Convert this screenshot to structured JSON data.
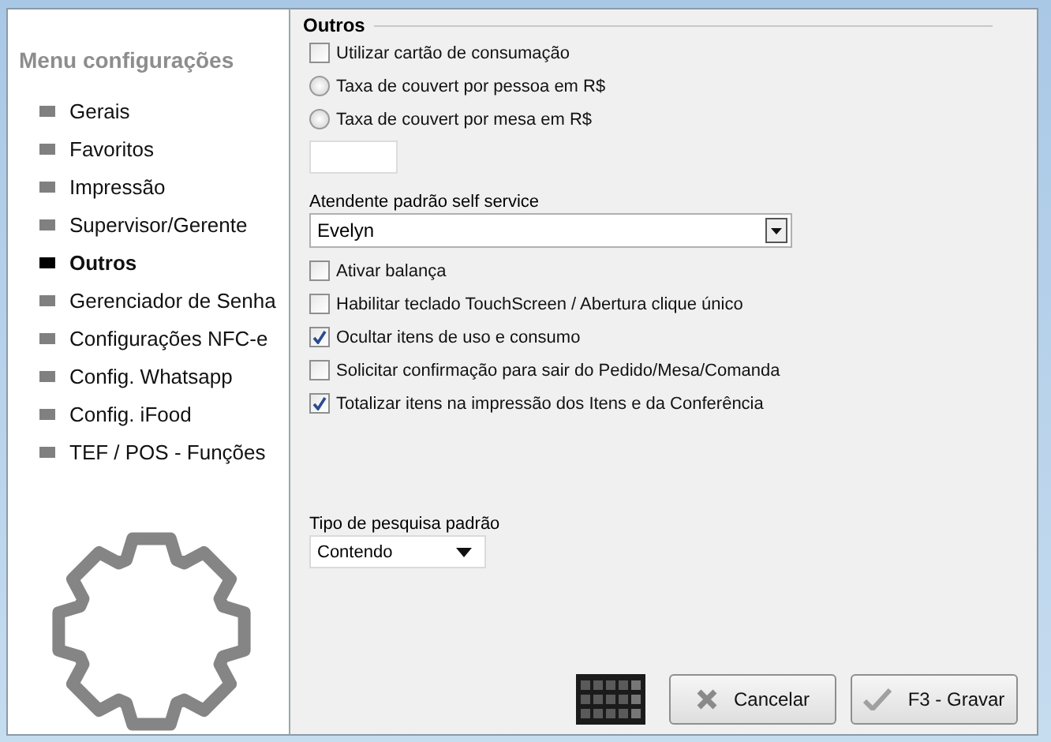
{
  "sidebar": {
    "title": "Menu configurações",
    "items": [
      {
        "label": "Gerais",
        "selected": false
      },
      {
        "label": "Favoritos",
        "selected": false
      },
      {
        "label": "Impressão",
        "selected": false
      },
      {
        "label": "Supervisor/Gerente",
        "selected": false
      },
      {
        "label": "Outros",
        "selected": true
      },
      {
        "label": "Gerenciador de Senha",
        "selected": false
      },
      {
        "label": "Configurações NFC-e",
        "selected": false
      },
      {
        "label": "Config. Whatsapp",
        "selected": false
      },
      {
        "label": "Config. iFood",
        "selected": false
      },
      {
        "label": "TEF / POS - Funções",
        "selected": false
      }
    ]
  },
  "section": {
    "title": "Outros",
    "controls": [
      {
        "kind": "checkbox",
        "label": "Utilizar cartão de consumação",
        "checked": false
      },
      {
        "kind": "radio",
        "label": "Taxa de couvert por pessoa em R$",
        "selected": false
      },
      {
        "kind": "radio",
        "label": "Taxa de couvert por mesa em R$",
        "selected": false
      },
      {
        "kind": "input"
      },
      {
        "kind": "select",
        "label": "Atendente padrão self service",
        "value": "Evelyn"
      },
      {
        "kind": "checkbox",
        "label": "Ativar balança",
        "checked": false
      },
      {
        "kind": "checkbox",
        "label": "Habilitar teclado TouchScreen / Abertura clique único",
        "checked": false
      },
      {
        "kind": "checkbox",
        "label": "Ocultar itens de uso e consumo",
        "checked": true
      },
      {
        "kind": "checkbox",
        "label": "Solicitar confirmação para sair do Pedido/Mesa/Comanda",
        "checked": false
      },
      {
        "kind": "checkbox",
        "label": "Totalizar itens na impressão dos Itens e da Conferência",
        "checked": true
      }
    ]
  },
  "search_type": {
    "label": "Tipo de pesquisa padrão",
    "value": "Contendo"
  },
  "buttons": [
    {
      "kind": "cancel",
      "label": "Cancelar"
    },
    {
      "kind": "save",
      "label": "F3 - Gravar"
    }
  ]
}
